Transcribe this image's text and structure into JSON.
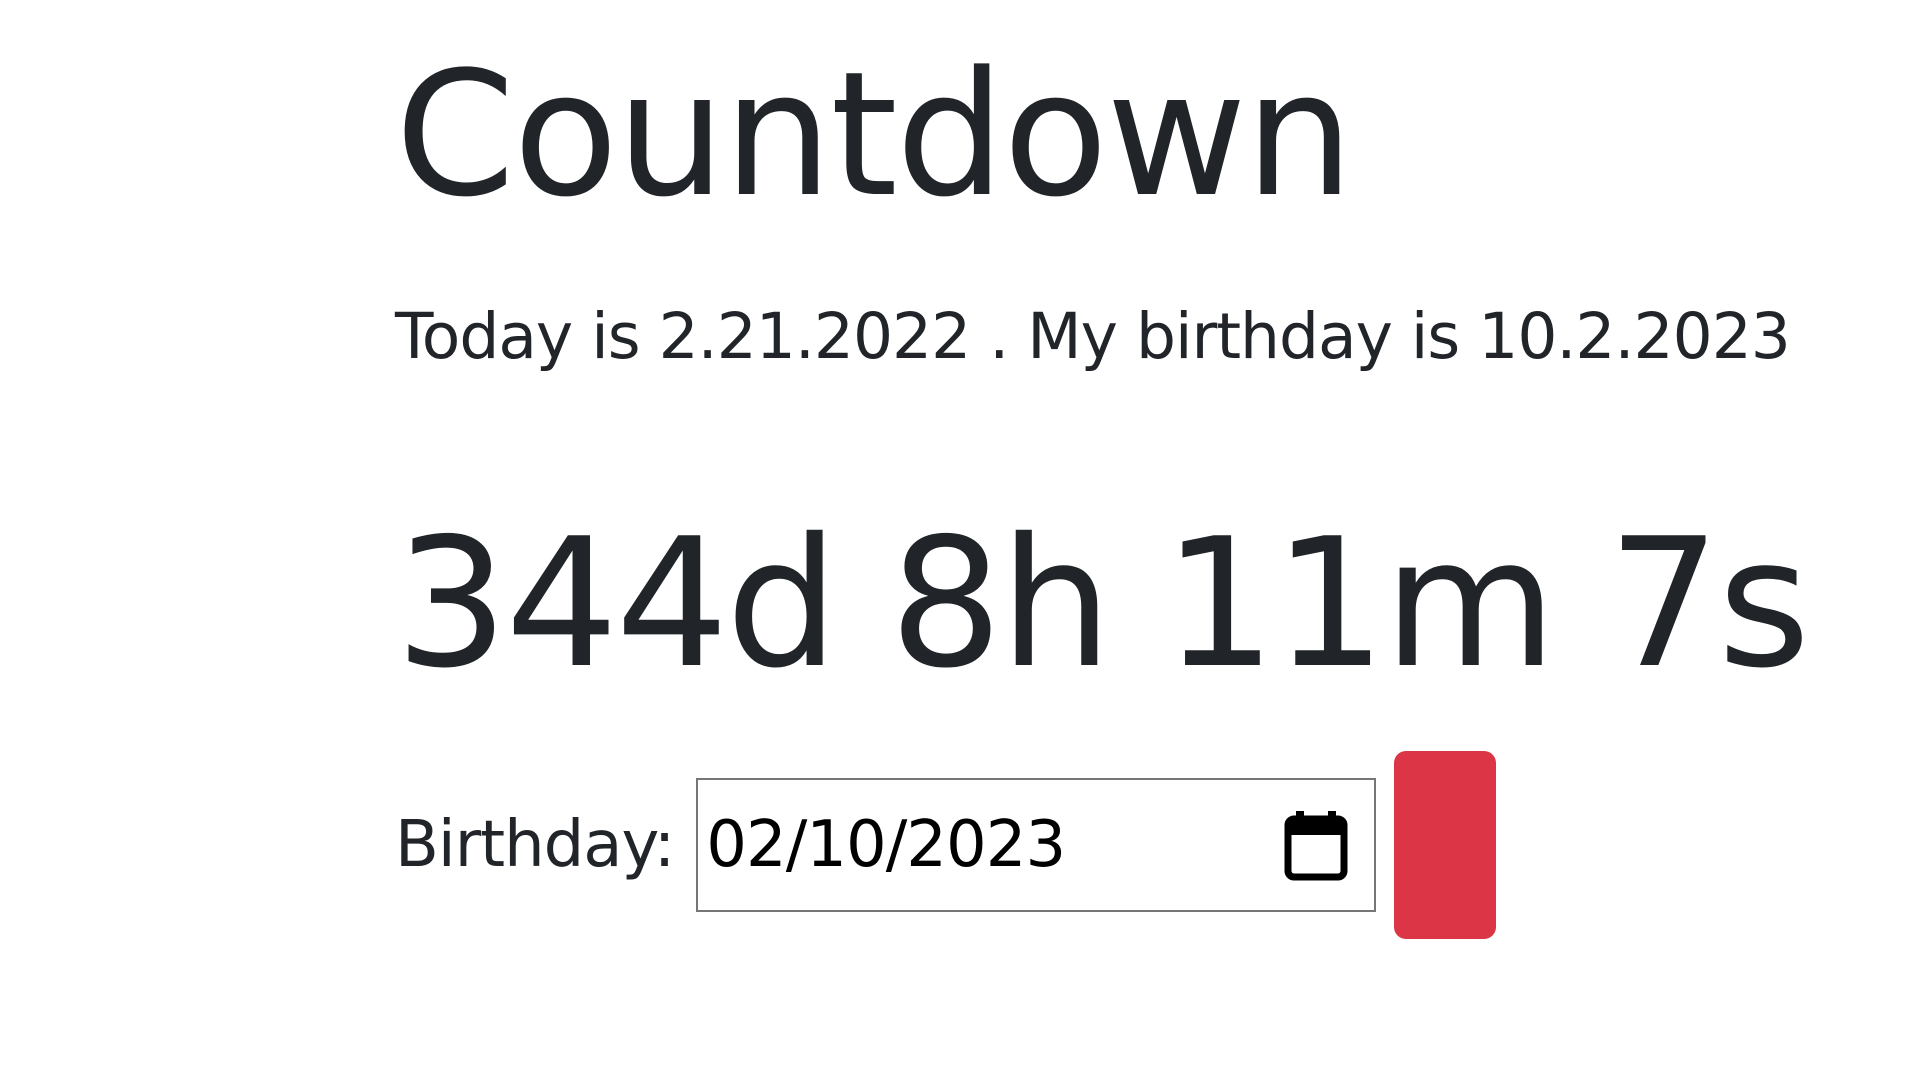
{
  "heading": {
    "title": "Countdown"
  },
  "info": {
    "today_text": "Today is 2.21.2022 . My birthday is 10.2.2023"
  },
  "countdown": {
    "display": "344d 8h 11m 7s"
  },
  "form": {
    "label": "Birthday:",
    "date_value": "02/10/2023",
    "calendar_icon": "calendar-icon",
    "button_label": "",
    "button_color": "#dc3545"
  }
}
